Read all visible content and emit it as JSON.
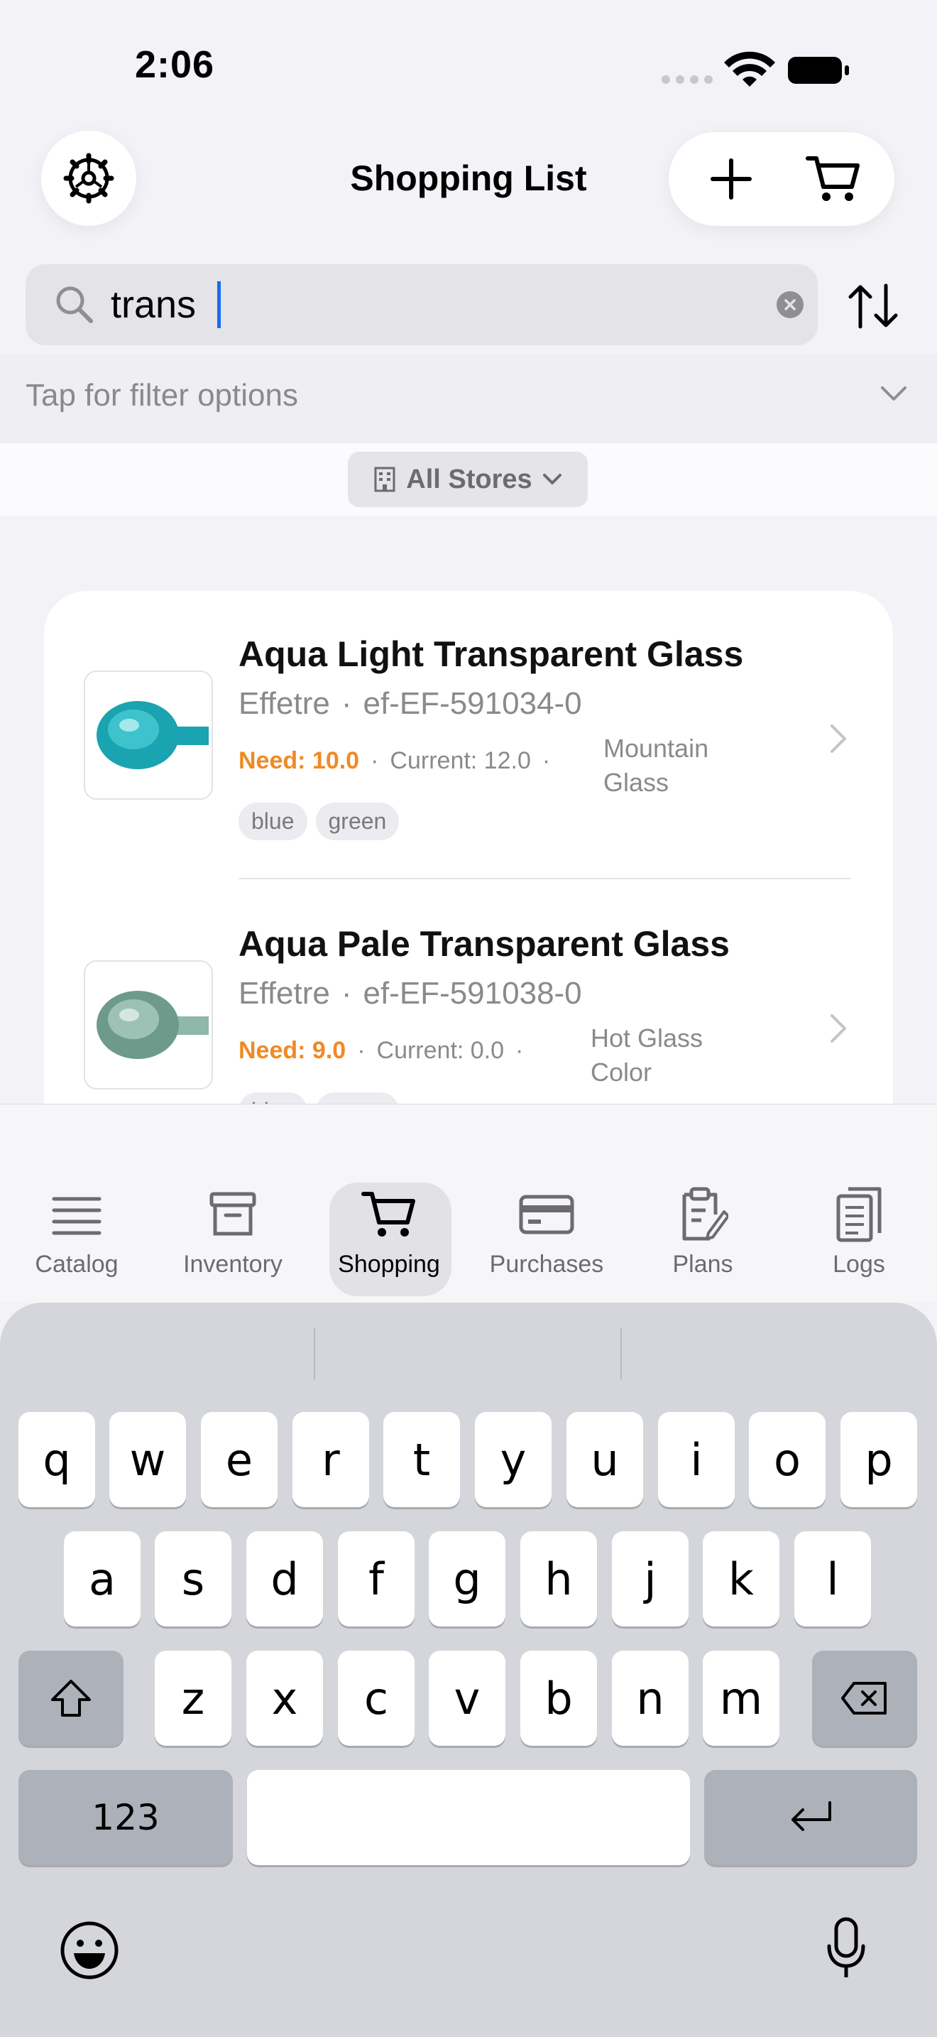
{
  "status_bar": {
    "time": "2:06"
  },
  "header": {
    "title": "Shopping List",
    "settings_icon": "gear-icon",
    "add_icon": "plus-icon",
    "cart_icon": "cart-icon"
  },
  "search": {
    "value": "trans",
    "placeholder": ""
  },
  "filter": {
    "label": "Tap for filter options"
  },
  "stores": {
    "label": "All Stores"
  },
  "items": [
    {
      "title": "Aqua Light Transparent Glass",
      "brand": "Effetre",
      "code": "ef-EF-591034-0",
      "need": "Need: 10.0",
      "current": "Current: 12.0",
      "store_line1": "Mountain",
      "store_line2": "Glass",
      "tags": [
        "blue",
        "green"
      ],
      "color": "#1aa3b0"
    },
    {
      "title": "Aqua Pale Transparent Glass",
      "brand": "Effetre",
      "code": "ef-EF-591038-0",
      "need": "Need: 9.0",
      "current": "Current: 0.0",
      "store_line1": "Hot Glass",
      "store_line2": "Color",
      "tags": [
        "blue",
        "green"
      ],
      "color": "#8fb8a8"
    }
  ],
  "tabs": [
    {
      "label": "Catalog",
      "icon": "list-icon"
    },
    {
      "label": "Inventory",
      "icon": "archive-box-icon"
    },
    {
      "label": "Shopping",
      "icon": "cart-icon",
      "active": true
    },
    {
      "label": "Purchases",
      "icon": "credit-card-icon"
    },
    {
      "label": "Plans",
      "icon": "clipboard-pencil-icon"
    },
    {
      "label": "Logs",
      "icon": "documents-icon"
    }
  ],
  "keyboard": {
    "row1": [
      "q",
      "w",
      "e",
      "r",
      "t",
      "y",
      "u",
      "i",
      "o",
      "p"
    ],
    "row2": [
      "a",
      "s",
      "d",
      "f",
      "g",
      "h",
      "j",
      "k",
      "l"
    ],
    "row3": [
      "z",
      "x",
      "c",
      "v",
      "b",
      "n",
      "m"
    ],
    "numbers_label": "123"
  },
  "colors": {
    "accent_orange": "#f08a24",
    "caret_blue": "#1a6cf0"
  }
}
